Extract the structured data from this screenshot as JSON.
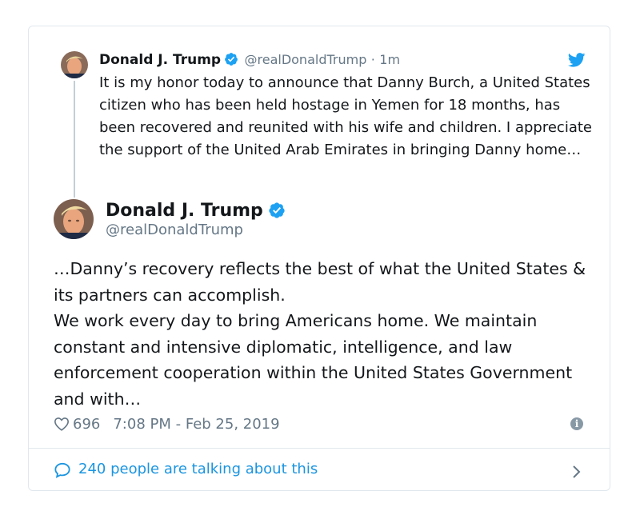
{
  "parent_tweet": {
    "name": "Donald J. Trump",
    "handle": "@realDonaldTrump",
    "separator": "·",
    "time": "1m",
    "text": "It is my honor today to announce that Danny Burch, a United States citizen who has been held hostage in Yemen for 18 months, has been recovered and reunited with his wife and children. I appreciate the support of the United Arab Emirates in bringing Danny home…",
    "avatar_icon": "user-avatar-icon",
    "platform_icon": "twitter-bird-icon"
  },
  "main_tweet": {
    "name": "Donald J. Trump",
    "handle": "@realDonaldTrump",
    "text_lines": [
      "…Danny’s recovery reflects the best of what the United States & its partners can accomplish.",
      "We work every day to bring Americans home. We maintain constant and intensive diplomatic, intelligence, and law enforcement cooperation within the United States Government and with…"
    ],
    "likes": "696",
    "timestamp": "7:08 PM - Feb 25, 2019",
    "info_icon": "info-icon"
  },
  "footer": {
    "talking_label": "240 people are talking about this",
    "icon": "comment-bubble-icon"
  },
  "colors": {
    "twitter_blue": "#1da1f2",
    "link_blue": "#1b95e0",
    "secondary_text": "#657786",
    "border": "#e1e8ed"
  }
}
